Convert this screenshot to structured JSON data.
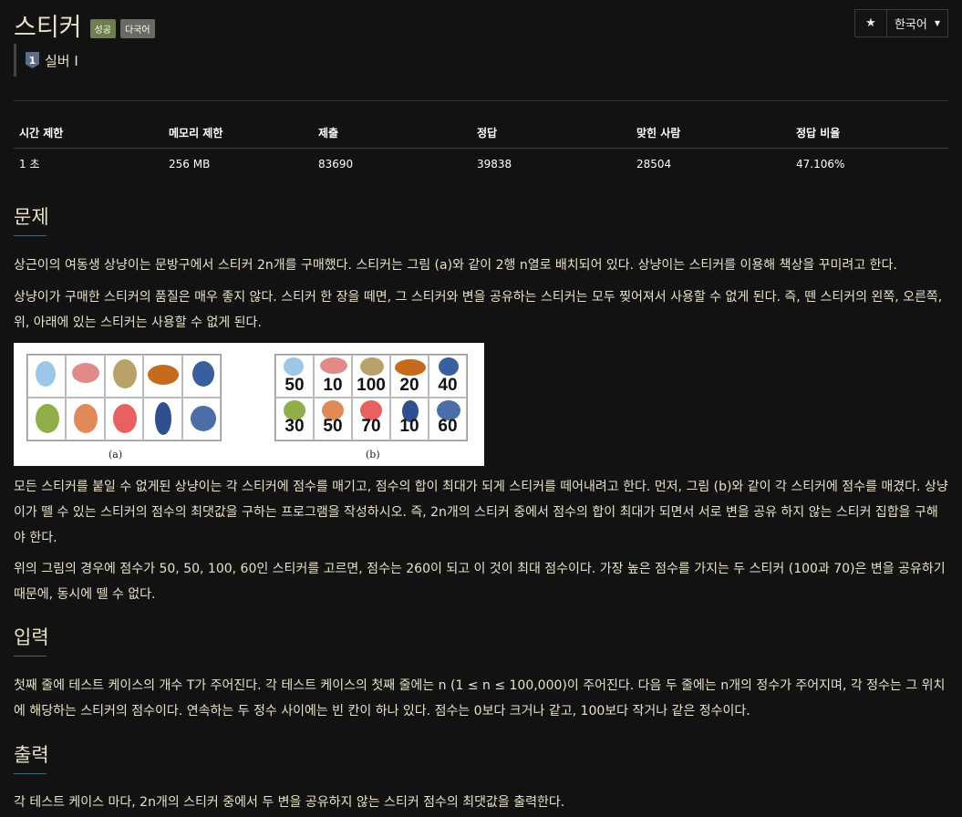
{
  "header": {
    "title": "스티커",
    "labels": {
      "success": "성공",
      "multilang": "다국어"
    },
    "star_icon": "★",
    "lang_select": "한국어",
    "caret": "▼",
    "tier": {
      "badge": "1",
      "text": "실버 I"
    }
  },
  "stats": {
    "headers": [
      "시간 제한",
      "메모리 제한",
      "제출",
      "정답",
      "맞힌 사람",
      "정답 비율"
    ],
    "values": [
      "1 초",
      "256 MB",
      "83690",
      "39838",
      "28504",
      "47.106%"
    ]
  },
  "problem": {
    "heading": "문제",
    "p1": "상근이의 여동생 상냥이는 문방구에서 스티커 2n개를 구매했다. 스티커는 그림 (a)와 같이 2행 n열로 배치되어 있다. 상냥이는 스티커를 이용해 책상을 꾸미려고 한다.",
    "p2": "상냥이가 구매한 스티커의 품질은 매우 좋지 않다. 스티커 한 장을 떼면, 그 스티커와 변을 공유하는 스티커는 모두 찢어져서 사용할 수 없게 된다. 즉, 뗀 스티커의 왼쪽, 오른쪽, 위, 아래에 있는 스티커는 사용할 수 없게 된다.",
    "figure": {
      "caption_a": "(a)",
      "caption_b": "(b)",
      "scores_top": [
        "50",
        "10",
        "100",
        "20",
        "40"
      ],
      "scores_bottom": [
        "30",
        "50",
        "70",
        "10",
        "60"
      ]
    },
    "p3": "모든 스티커를 붙일 수 없게된 상냥이는 각 스티커에 점수를 매기고, 점수의 합이 최대가 되게 스티커를 떼어내려고 한다. 먼저, 그림 (b)와 같이 각 스티커에 점수를 매겼다. 상냥이가 뗄 수 있는 스티커의 점수의 최댓값을 구하는 프로그램을 작성하시오. 즉, 2n개의 스티커 중에서 점수의 합이 최대가 되면서 서로 변을 공유 하지 않는 스티커 집합을 구해야 한다.",
    "p4": "위의 그림의 경우에 점수가 50, 50, 100, 60인 스티커를 고르면, 점수는 260이 되고 이 것이 최대 점수이다. 가장 높은 점수를 가지는 두 스티커 (100과 70)은 변을 공유하기 때문에, 동시에 뗄 수 없다."
  },
  "input": {
    "heading": "입력",
    "p1": "첫째 줄에 테스트 케이스의 개수 T가 주어진다. 각 테스트 케이스의 첫째 줄에는 n (1 ≤ n ≤ 100,000)이 주어진다. 다음 두 줄에는 n개의 정수가 주어지며, 각 정수는 그 위치에 해당하는 스티커의 점수이다. 연속하는 두 정수 사이에는 빈 칸이 하나 있다. 점수는 0보다 크거나 같고, 100보다 작거나 같은 정수이다."
  },
  "output": {
    "heading": "출력",
    "p1": "각 테스트 케이스 마다, 2n개의 스티커 중에서 두 변을 공유하지 않는 스티커 점수의 최댓값을 출력한다."
  }
}
